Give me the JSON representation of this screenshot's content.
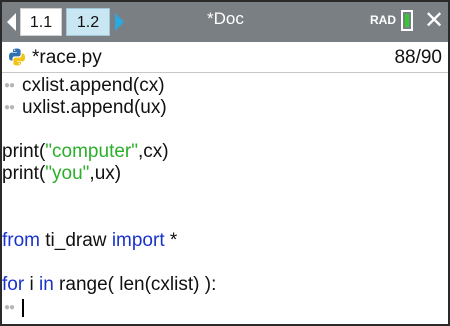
{
  "tabs": [
    {
      "label": "1.1",
      "active": true
    },
    {
      "label": "1.2",
      "active": false
    }
  ],
  "document_title": "*Doc",
  "mode_indicator": "RAD",
  "file": {
    "name": "*race.py",
    "line_counter": "88/90"
  },
  "code": {
    "line1": "cxlist.append(cx)",
    "line2": "uxlist.append(ux)",
    "print1_fn": "print(",
    "print1_str": "\"computer\"",
    "print1_rest": ",cx)",
    "print2_fn": "print(",
    "print2_str": "\"you\"",
    "print2_rest": ",ux)",
    "import_from": "from",
    "import_module": " ti_draw ",
    "import_kw": "import",
    "import_star": " *",
    "for_kw": "for",
    "for_var": " i ",
    "in_kw": "in",
    "for_rest": " range( len(cxlist) ):"
  },
  "colors": {
    "keyword": "#1a33cc",
    "string": "#2bb02b",
    "tab_bar": "#7a7f83"
  }
}
